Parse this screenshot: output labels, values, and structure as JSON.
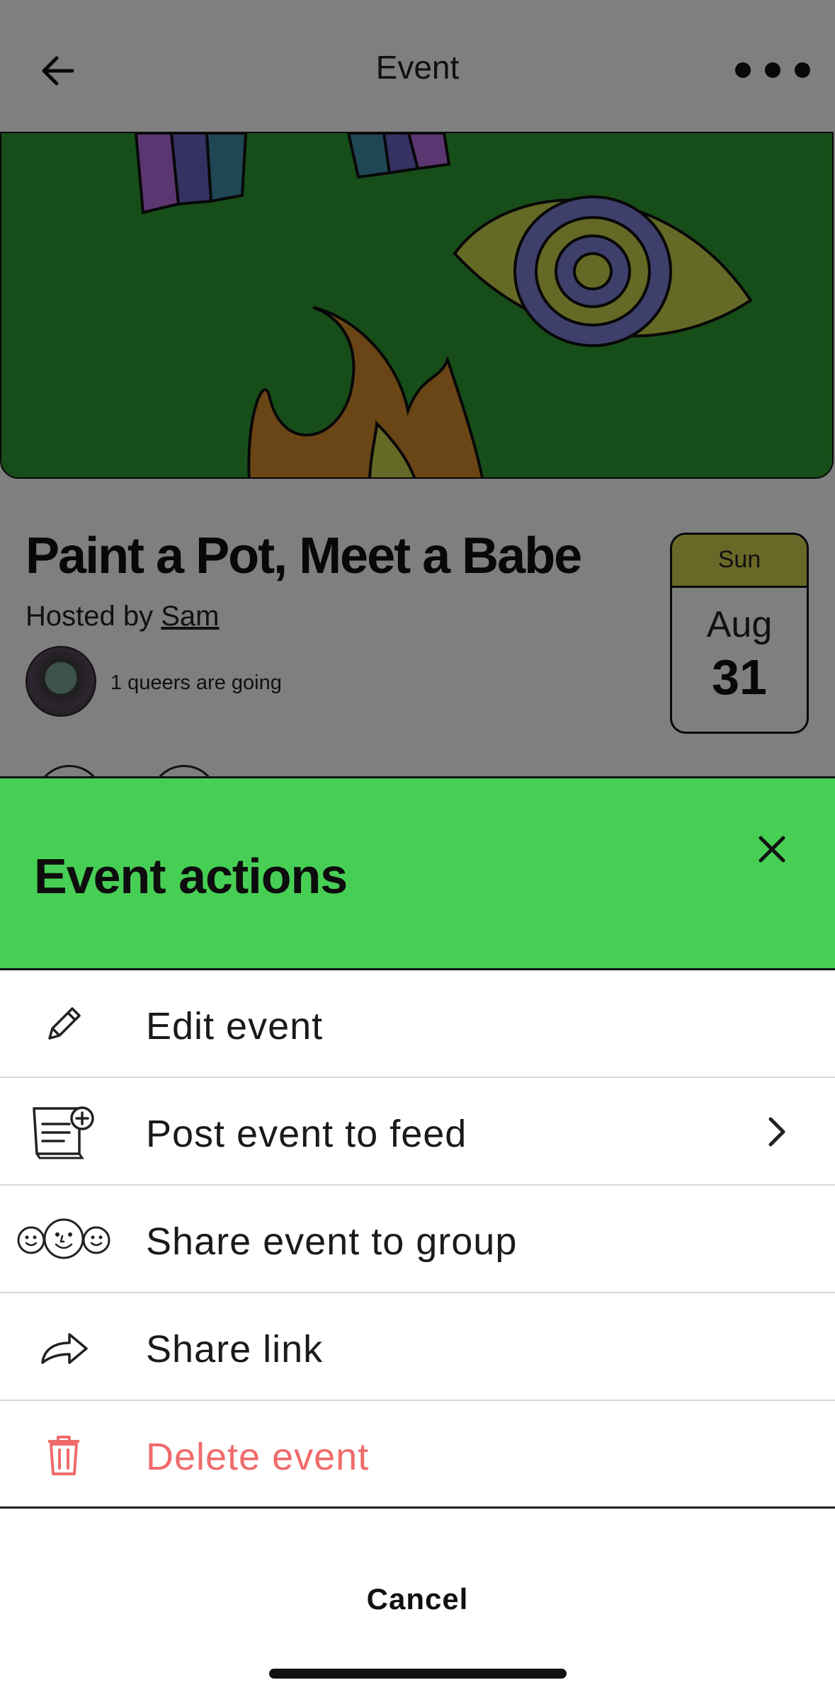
{
  "nav": {
    "title": "Event",
    "back_icon": "arrow-left-icon",
    "more_icon": "ellipsis-icon"
  },
  "event": {
    "title": "Paint a Pot, Meet a Babe",
    "hosted_by_prefix": "Hosted by ",
    "host_name": "Sam",
    "attendance": "1 queers are going",
    "date": {
      "weekday": "Sun",
      "month": "Aug",
      "day": "31"
    }
  },
  "sheet": {
    "title": "Event actions",
    "close_icon": "close-icon",
    "actions": [
      {
        "label": "Edit event",
        "icon": "pencil-icon"
      },
      {
        "label": "Post event to feed",
        "icon": "post-to-feed-icon",
        "has_chevron": true
      },
      {
        "label": "Share event to group",
        "icon": "group-faces-icon"
      },
      {
        "label": "Share link",
        "icon": "share-arrow-icon"
      },
      {
        "label": "Delete event",
        "icon": "trash-icon",
        "destructive": true
      }
    ],
    "cancel_label": "Cancel"
  },
  "colors": {
    "sheet_header": "#47cf55",
    "destructive": "#f06b6b",
    "hero_background": "#2e9a33",
    "date_header": "#d4d14e"
  }
}
